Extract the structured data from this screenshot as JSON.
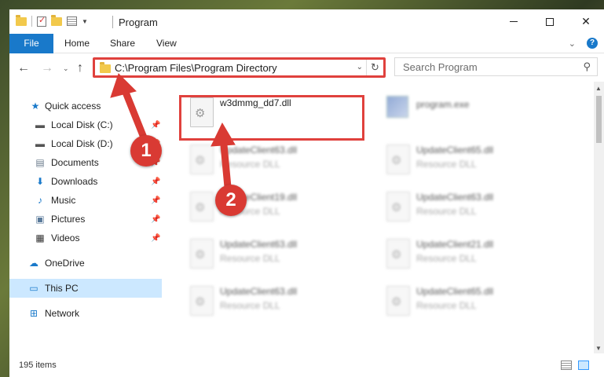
{
  "window": {
    "title": "Program"
  },
  "ribbon": {
    "tabs": [
      "File",
      "Home",
      "Share",
      "View"
    ]
  },
  "address": {
    "path": "C:\\Program Files\\Program Directory",
    "search_placeholder": "Search Program"
  },
  "sidebar": {
    "items": [
      {
        "label": "Quick access",
        "icon": "star-icon"
      },
      {
        "label": "Local Disk (C:)",
        "icon": "drive-icon"
      },
      {
        "label": "Local Disk (D:)",
        "icon": "drive-icon"
      },
      {
        "label": "Documents",
        "icon": "documents-icon"
      },
      {
        "label": "Downloads",
        "icon": "download-icon"
      },
      {
        "label": "Music",
        "icon": "music-icon"
      },
      {
        "label": "Pictures",
        "icon": "pictures-icon"
      },
      {
        "label": "Videos",
        "icon": "videos-icon"
      },
      {
        "label": "OneDrive",
        "icon": "cloud-icon"
      },
      {
        "label": "This PC",
        "icon": "computer-icon"
      },
      {
        "label": "Network",
        "icon": "network-icon"
      }
    ]
  },
  "files": [
    {
      "name": "w3dmmg_dd7.dll",
      "type": ""
    },
    {
      "name": "program.exe",
      "type": ""
    },
    {
      "name": "UpdateClient63.dll",
      "type": "Resource DLL"
    },
    {
      "name": "UpdateClient65.dll",
      "type": "Resource DLL"
    },
    {
      "name": "UpdateClient19.dll",
      "type": "Resource DLL"
    },
    {
      "name": "UpdateClient63.dll",
      "type": "Resource DLL"
    },
    {
      "name": "UpdateClient63.dll",
      "type": "Resource DLL"
    },
    {
      "name": "UpdateClient21.dll",
      "type": "Resource DLL"
    },
    {
      "name": "UpdateClient63.dll",
      "type": "Resource DLL"
    },
    {
      "name": "UpdateClient65.dll",
      "type": "Resource DLL"
    }
  ],
  "status": {
    "item_count": "195 items"
  },
  "annotations": {
    "badge1": "1",
    "badge2": "2",
    "color": "#d93a33"
  }
}
